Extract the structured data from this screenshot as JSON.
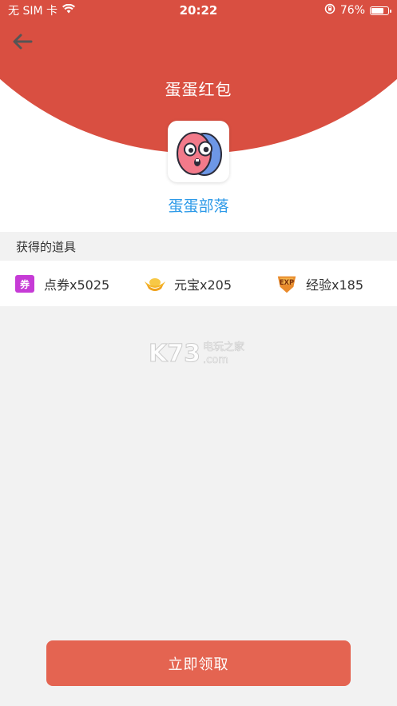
{
  "status_bar": {
    "carrier": "无 SIM 卡",
    "time": "20:22",
    "battery_percent": "76%",
    "battery_level": 0.76
  },
  "header": {
    "title": "蛋蛋红包"
  },
  "app": {
    "name": "蛋蛋部落"
  },
  "items_section": {
    "label": "获得的道具",
    "items": [
      {
        "icon": "coupon-icon",
        "label": "点券x5025"
      },
      {
        "icon": "gold-ingot-icon",
        "label": "元宝x205"
      },
      {
        "icon": "exp-badge-icon",
        "label": "经验x185"
      }
    ]
  },
  "watermark": {
    "brand": "K73",
    "cn": "电玩之家",
    "domain": ".com"
  },
  "actions": {
    "claim_label": "立即领取"
  },
  "colors": {
    "header_red": "#d94f41",
    "button_red": "#e46451",
    "app_name_blue": "#2d9ae8",
    "background": "#f2f2f2"
  }
}
